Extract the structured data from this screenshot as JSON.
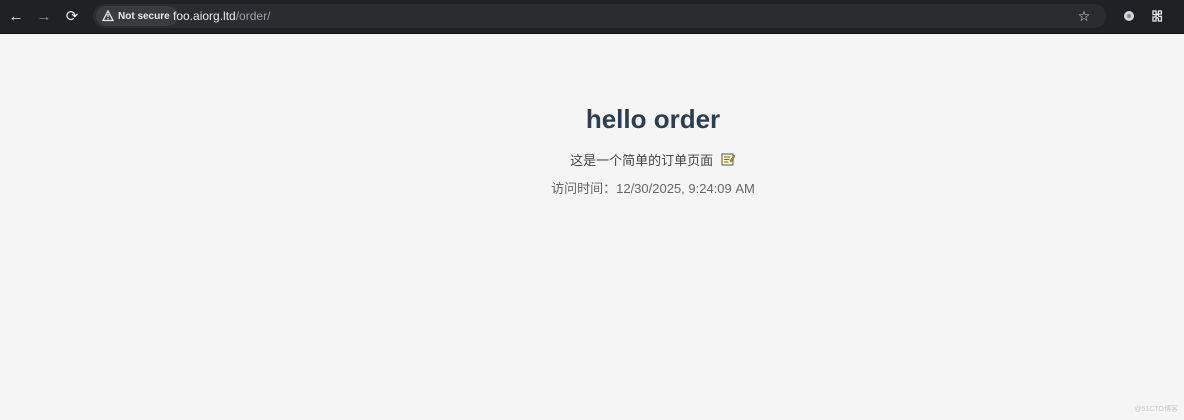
{
  "browser": {
    "security_label": "Not secure",
    "url_host": "foo.aiorg.ltd",
    "url_path": "/order/",
    "icons": {
      "back": "arrow-left-icon",
      "forward": "arrow-right-icon",
      "reload": "reload-icon",
      "warning": "warning-icon",
      "star": "star-icon",
      "extension": "extension-icon",
      "puzzle": "puzzle-icon"
    }
  },
  "page": {
    "title": "hello order",
    "subtitle": "这是一个简单的订单页面",
    "visit_text": "访问时间：12/30/2025, 9:24:09 AM",
    "watermark": "@51CTO博客",
    "icons": {
      "memo": "memo-icon"
    }
  }
}
